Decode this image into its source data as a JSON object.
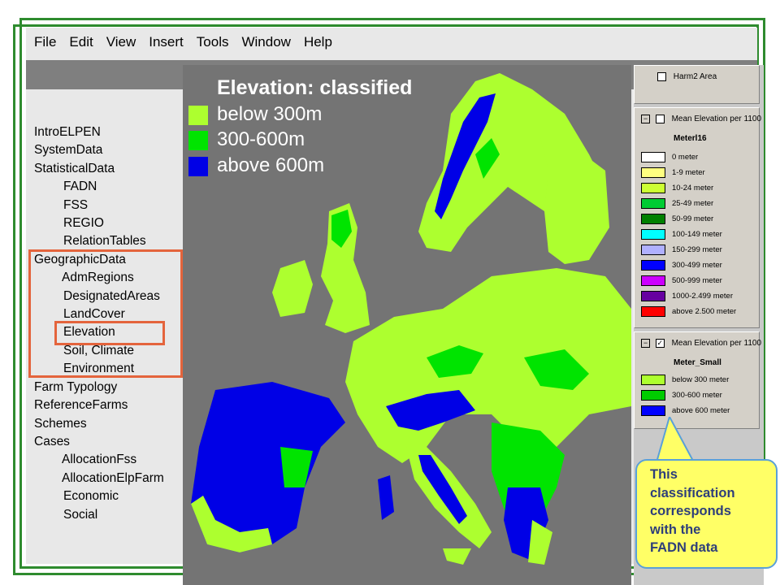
{
  "menu": [
    "File",
    "Edit",
    "View",
    "Insert",
    "Tools",
    "Window",
    "Help"
  ],
  "tree": {
    "items": [
      {
        "label": "IntroELPEN",
        "level": 0
      },
      {
        "label": "SystemData",
        "level": 0
      },
      {
        "label": "StatisticalData",
        "level": 0
      },
      {
        "label": "FADN",
        "level": 1
      },
      {
        "label": "FSS",
        "level": 1
      },
      {
        "label": "REGIO",
        "level": 1
      },
      {
        "label": "RelationTables",
        "level": 1
      },
      {
        "label": "GeographicData",
        "level": 0
      },
      {
        "label": "AdmRegions",
        "level": 1
      },
      {
        "label": "DesignatedAreas",
        "level": 1
      },
      {
        "label": "LandCover",
        "level": 1
      },
      {
        "label": "Elevation",
        "level": 1,
        "highlighted": true
      },
      {
        "label": "Soil, Climate",
        "level": 1
      },
      {
        "label": "Environment",
        "level": 1
      },
      {
        "label": "Farm Typology",
        "level": 0
      },
      {
        "label": "ReferenceFarms",
        "level": 0
      },
      {
        "label": "Schemes",
        "level": 0
      },
      {
        "label": "Cases",
        "level": 0
      },
      {
        "label": "AllocationFss",
        "level": 1
      },
      {
        "label": "AllocationElpFarm",
        "level": 1
      },
      {
        "label": "Economic",
        "level": 1
      },
      {
        "label": "Social",
        "level": 1
      }
    ]
  },
  "map_legend": {
    "title": "Elevation: classified",
    "items": [
      {
        "label": "below 300m",
        "color": "#ADFF2F"
      },
      {
        "label": "300-600m",
        "color": "#00E400"
      },
      {
        "label": "above 600m",
        "color": "#0000E6"
      }
    ]
  },
  "layers": {
    "harm2": {
      "label": "Harm2 Area",
      "checked": false
    },
    "mean1": {
      "label": "Mean Elevation per 1100",
      "checked": false,
      "legend_name": "Meterl16",
      "classes": [
        {
          "label": "0 meter",
          "color": "#FFFFFF"
        },
        {
          "label": "1-9 meter",
          "color": "#FFFF80"
        },
        {
          "label": "10-24 meter",
          "color": "#CCFF33"
        },
        {
          "label": "25-49 meter",
          "color": "#00CC33"
        },
        {
          "label": "50-99 meter",
          "color": "#008000"
        },
        {
          "label": "100-149 meter",
          "color": "#00FFFF"
        },
        {
          "label": "150-299 meter",
          "color": "#B0B0FF"
        },
        {
          "label": "300-499 meter",
          "color": "#0000FF"
        },
        {
          "label": "500-999 meter",
          "color": "#CC00FF"
        },
        {
          "label": "1000-2.499 meter",
          "color": "#6600A0"
        },
        {
          "label": "above 2.500 meter",
          "color": "#FF0000"
        }
      ]
    },
    "mean2": {
      "label": "Mean Elevation per 1100",
      "checked": true,
      "legend_name": "Meter_Small",
      "classes": [
        {
          "label": "below 300 meter",
          "color": "#ADFF2F"
        },
        {
          "label": "300-600 meter",
          "color": "#00CC00"
        },
        {
          "label": "above 600 meter",
          "color": "#0000FF"
        }
      ]
    }
  },
  "callout": {
    "lines": [
      "This",
      "classification",
      "corresponds",
      "with the",
      "FADN data"
    ]
  },
  "colors": {
    "frame": "#2e8b2e",
    "highlight": "#e4643c",
    "map_background": "#747474",
    "callout_fill": "#ffff66",
    "callout_text": "#2e3e7a"
  }
}
